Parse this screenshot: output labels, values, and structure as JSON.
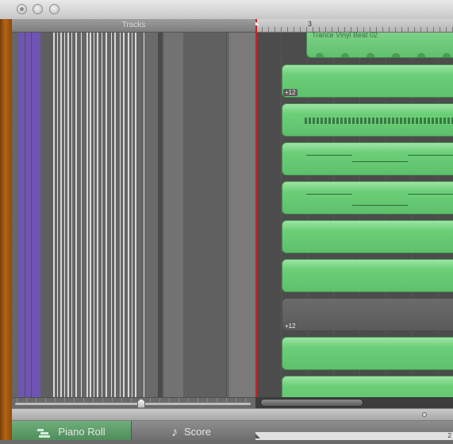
{
  "window": {
    "close_icon": "close-dot",
    "minimize_icon": "minimize-dot",
    "zoom_icon": "zoom-dot"
  },
  "tracks_panel": {
    "title": "Tracks"
  },
  "ruler": {
    "bar_number": "3"
  },
  "loop_region": {
    "name": "Trance Vinyl Beat 02"
  },
  "regions": [
    {
      "badge": "+12"
    },
    {
      "badge": ""
    },
    {
      "badge": ""
    },
    {
      "badge": ""
    },
    {
      "badge": ""
    },
    {
      "badge": ""
    },
    {
      "badge": "+12"
    },
    {
      "badge": ""
    },
    {
      "badge": ""
    }
  ],
  "tabs": {
    "piano_roll": "Piano Roll",
    "score": "Score"
  },
  "mini_ruler": {
    "mark": "2"
  },
  "colors": {
    "accent_green": "#6ccf78",
    "playhead_red": "#c42222",
    "track_purple": "#6f55b3",
    "wood": "#b36515"
  }
}
